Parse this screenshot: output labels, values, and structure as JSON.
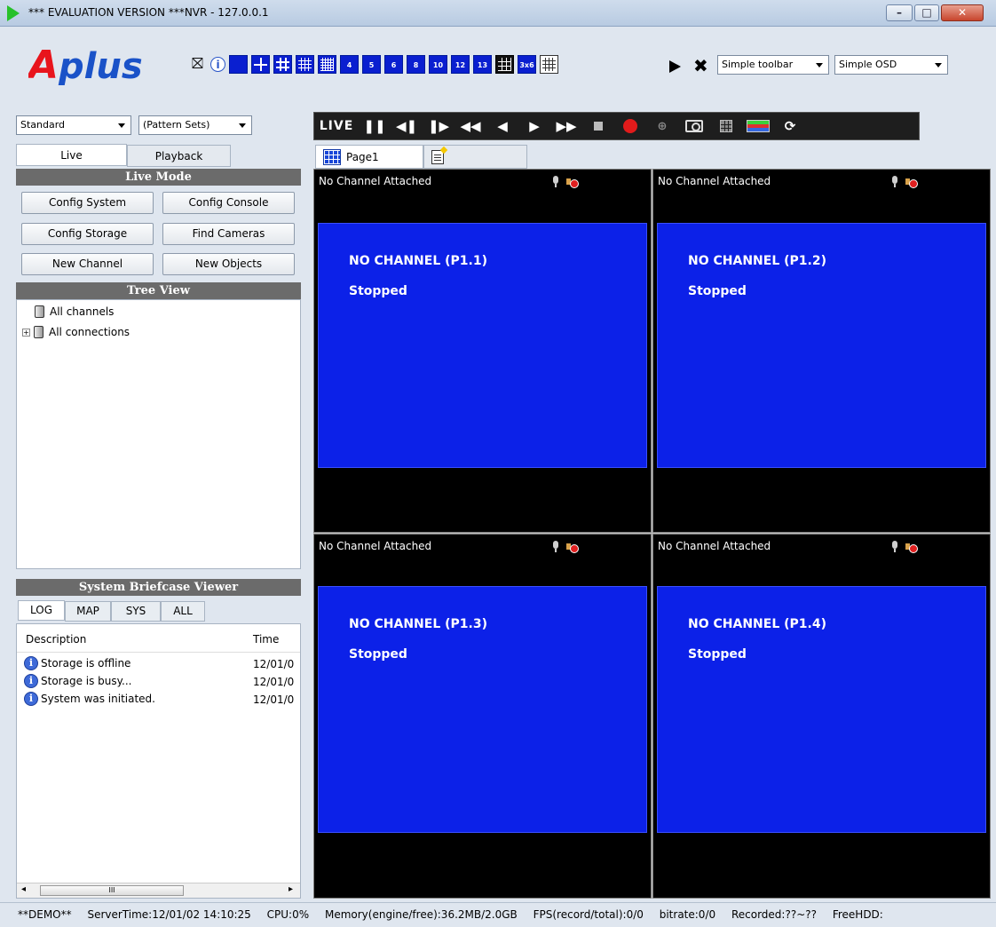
{
  "window": {
    "title": "*** EVALUATION VERSION ***NVR - 127.0.0.1"
  },
  "toolbar": {
    "logo_text": "Aplus",
    "layout_labels": [
      "4",
      "5",
      "6",
      "8",
      "10",
      "12",
      "13",
      "3x6"
    ],
    "toolbar_style": "Simple toolbar",
    "osd_style": "Simple OSD",
    "icons": [
      "exit-icon",
      "info-icon",
      "layout-1-icon",
      "layout-4-icon",
      "layout-9-icon",
      "layout-16-icon",
      "layout-25-icon",
      "play-icon",
      "close-icon"
    ]
  },
  "left": {
    "mode_select": "Standard",
    "pattern_select": "(Pattern Sets)",
    "tabs": [
      "Live",
      "Playback"
    ],
    "live_mode_title": "Live Mode",
    "buttons": [
      "Config System",
      "Config Console",
      "Config Storage",
      "Find Cameras",
      "New Channel",
      "New Objects"
    ],
    "tree_title": "Tree View",
    "tree": [
      "All channels",
      "All connections"
    ],
    "briefcase_title": "System Briefcase Viewer",
    "briefcase_tabs": [
      "LOG",
      "MAP",
      "SYS",
      "ALL"
    ],
    "log_columns": [
      "Description",
      "Time"
    ],
    "log_rows": [
      {
        "desc": "Storage is offline",
        "time": "12/01/0"
      },
      {
        "desc": "Storage is busy...",
        "time": "12/01/0"
      },
      {
        "desc": "System was initiated.",
        "time": "12/01/0"
      }
    ],
    "scroll_thumb_label": "III"
  },
  "controls": {
    "live_label": "LIVE"
  },
  "pages": {
    "tab1": "Page1"
  },
  "cells": [
    {
      "caption": "No Channel Attached",
      "channel": "NO CHANNEL (P1.1)",
      "status": "Stopped"
    },
    {
      "caption": "No Channel Attached",
      "channel": "NO CHANNEL (P1.2)",
      "status": "Stopped"
    },
    {
      "caption": "No Channel Attached",
      "channel": "NO CHANNEL (P1.3)",
      "status": "Stopped"
    },
    {
      "caption": "No Channel Attached",
      "channel": "NO CHANNEL (P1.4)",
      "status": "Stopped"
    }
  ],
  "status": {
    "demo": "**DEMO**",
    "server_time": "ServerTime:12/01/02 14:10:25",
    "cpu": "CPU:0%",
    "memory": "Memory(engine/free):36.2MB/2.0GB",
    "fps": "FPS(record/total):0/0",
    "bitrate": "bitrate:0/0",
    "recorded": "Recorded:??~??",
    "freehdd": "FreeHDD:"
  },
  "colors": {
    "video_blue": "#0c21e8",
    "logo_red": "#e8141c",
    "logo_blue": "#1a52c8",
    "record_red": "#e21b1b"
  }
}
